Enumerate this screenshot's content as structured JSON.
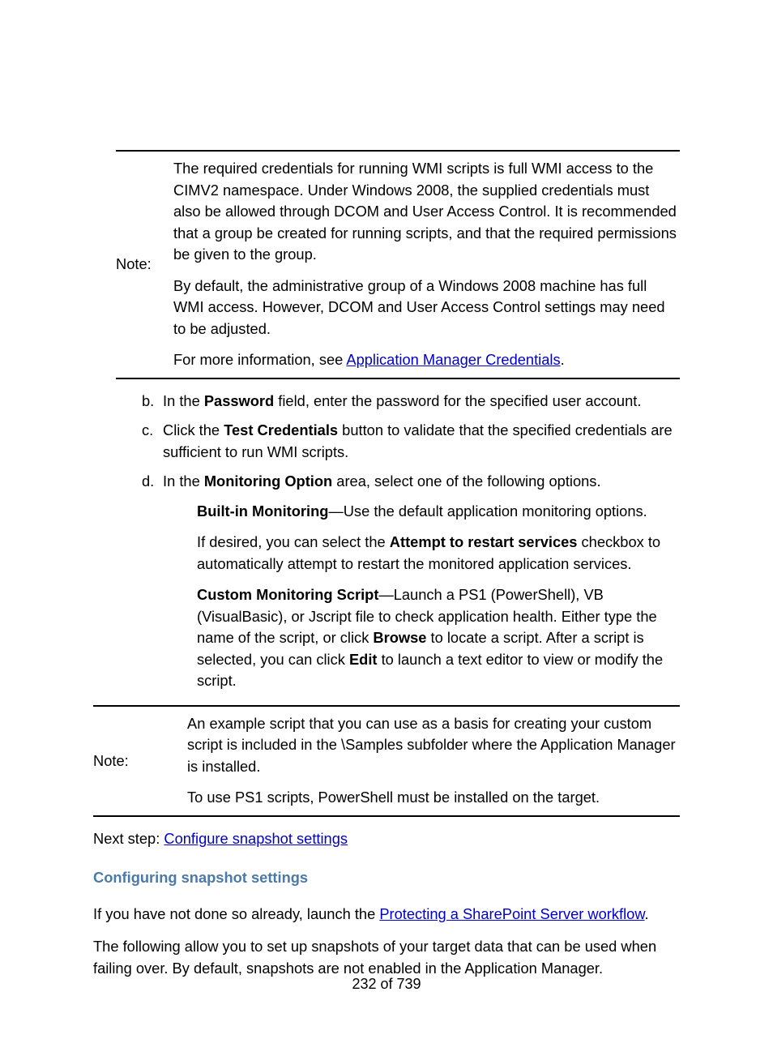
{
  "note1": {
    "label": "Note:",
    "p1": "The required credentials for running WMI scripts is full WMI access to the CIMV2 namespace. Under Windows 2008, the supplied credentials must also be allowed through DCOM and User Access Control. It is recommended that a group be created for running scripts, and that the required permissions be given to the group.",
    "p2": "By default, the administrative group of a Windows 2008 machine has full WMI access. However, DCOM and User Access Control settings may need to be adjusted.",
    "p3_prefix": "For more information, see ",
    "p3_link": "Application Manager Credentials",
    "p3_suffix": "."
  },
  "list": {
    "b": {
      "marker": "b.",
      "t1": "In the ",
      "bold1": "Password",
      "t2": " field, enter the password for the specified user account."
    },
    "c": {
      "marker": "c.",
      "t1": "Click the ",
      "bold1": "Test Credentials",
      "t2": " button to validate that the specified credentials are sufficient to run WMI scripts."
    },
    "d": {
      "marker": "d.",
      "t1": "In the ",
      "bold1": "Monitoring Option",
      "t2": " area, select one of the following options.",
      "opt1": {
        "bold": "Built-in Monitoring",
        "rest": "—Use the default application monitoring options."
      },
      "opt1b": {
        "t1": "If desired, you can select the ",
        "bold": "Attempt to restart services",
        "t2": " checkbox to automatically attempt to restart the monitored application services."
      },
      "opt2": {
        "bold1": "Custom Monitoring Script",
        "t1": "—Launch a PS1 (PowerShell), VB (VisualBasic), or Jscript file to check application health. Either type the name of the script, or click ",
        "bold2": "Browse",
        "t2": " to locate a script. After a script is selected, you can click ",
        "bold3": "Edit",
        "t3": " to launch a text editor to view or modify the script."
      }
    }
  },
  "note2": {
    "label": "Note:",
    "p1": "An example script that you can use as a basis for creating your custom script is included in the \\Samples subfolder where the Application Manager is installed.",
    "p2": "To use PS1 scripts, PowerShell must be installed on the target."
  },
  "nextstep": {
    "prefix": "Next step: ",
    "link": "Configure snapshot settings"
  },
  "heading": "Configuring snapshot settings",
  "para1": {
    "t1": "If you have not done so already, launch the ",
    "link": "Protecting a SharePoint Server workflow",
    "t2": "."
  },
  "para2": "The following allow you to set up snapshots of your target data that can be used when failing over. By default, snapshots are not enabled in the Application Manager.",
  "footer": "232 of 739"
}
